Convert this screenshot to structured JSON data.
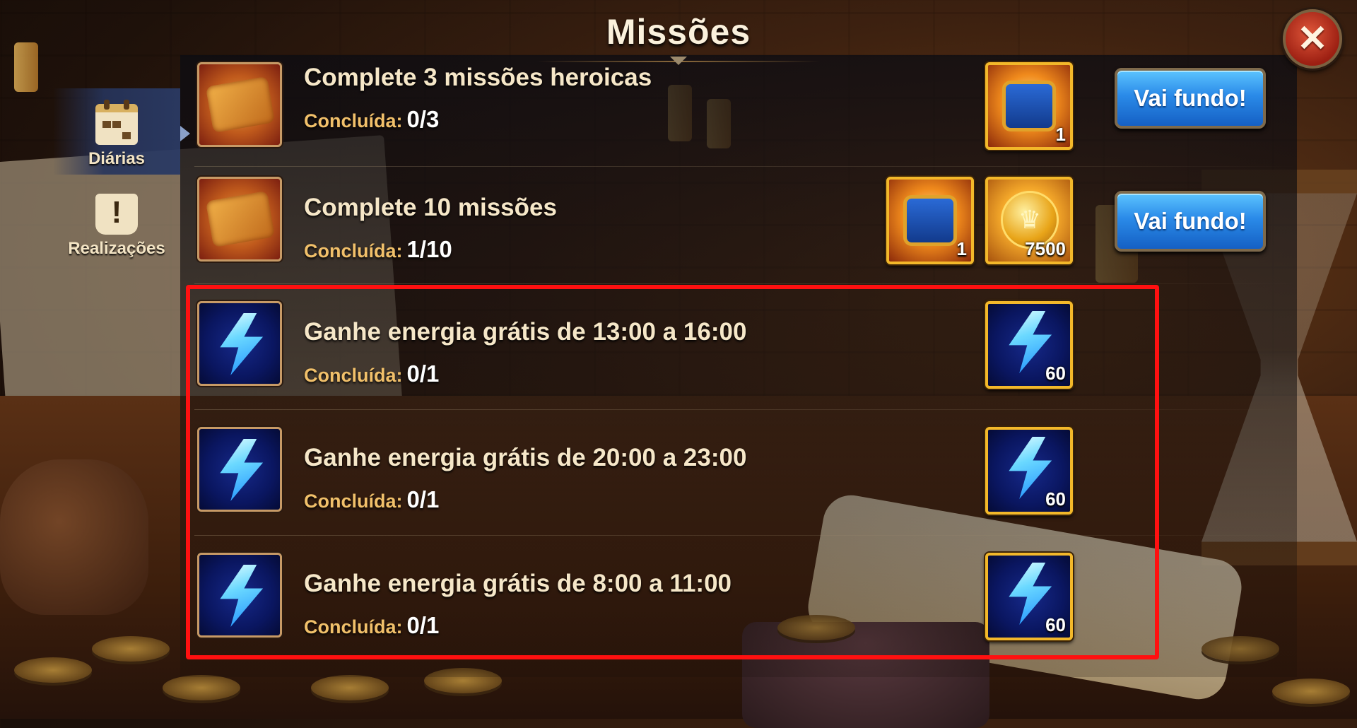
{
  "window": {
    "title": "Missões",
    "close_icon": "close-icon"
  },
  "sidebar": {
    "tabs": [
      {
        "label": "Diárias",
        "icon": "calendar-icon",
        "active": true
      },
      {
        "label": "Realizações",
        "icon": "scroll-exclamation-icon",
        "active": false
      }
    ]
  },
  "progress_label": "Concluída:",
  "missions": [
    {
      "title": "Complete 3 missões heroicas",
      "progress": "0/3",
      "icon": "scroll-icon",
      "rewards": [
        {
          "icon": "chest-icon",
          "quantity": "1"
        }
      ],
      "button": "Vai fundo!"
    },
    {
      "title": "Complete 10 missões",
      "progress": "1/10",
      "icon": "scroll-icon",
      "rewards": [
        {
          "icon": "chest-icon",
          "quantity": "1"
        },
        {
          "icon": "gold-coin-icon",
          "quantity": "7500"
        }
      ],
      "button": "Vai fundo!"
    },
    {
      "title": "Ganhe energia grátis de 13:00 a 16:00",
      "progress": "0/1",
      "icon": "energy-bolt-icon",
      "rewards": [
        {
          "icon": "energy-bolt-icon",
          "quantity": "60"
        }
      ]
    },
    {
      "title": "Ganhe energia grátis de 20:00 a 23:00",
      "progress": "0/1",
      "icon": "energy-bolt-icon",
      "rewards": [
        {
          "icon": "energy-bolt-icon",
          "quantity": "60"
        }
      ]
    },
    {
      "title": "Ganhe energia grátis de 8:00 a 11:00",
      "progress": "0/1",
      "icon": "energy-bolt-icon",
      "rewards": [
        {
          "icon": "energy-bolt-icon",
          "quantity": "60"
        }
      ]
    }
  ],
  "colors": {
    "highlight_border": "#ff1010",
    "button_blue": "#2a8ae8",
    "progress_label": "#f1c06a",
    "reward_border": "#f3b82a"
  }
}
